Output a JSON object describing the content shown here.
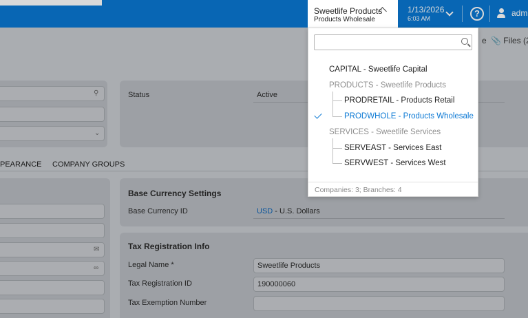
{
  "topbar": {
    "company_name": "Sweetlife Products",
    "branch_name": "Products Wholesale",
    "date": "1/13/2026",
    "time": "6:03 AM",
    "help_label": "?",
    "user_name": "adm"
  },
  "toolbar": {
    "partial_label": "e",
    "files_label": "Files (2"
  },
  "summary": {
    "status_label": "Status",
    "status_value": "Active"
  },
  "tabs": [
    "PEARANCE",
    "COMPANY GROUPS"
  ],
  "base_currency": {
    "heading": "Base Currency Settings",
    "label": "Base Currency ID",
    "code": "USD",
    "desc": " - U.S. Dollars"
  },
  "tax": {
    "heading": "Tax Registration Info",
    "legal_name_label": "Legal Name",
    "required_mark": "*",
    "legal_name_value": "Sweetlife Products",
    "tax_reg_label": "Tax Registration ID",
    "tax_reg_value": "190000060",
    "tax_exempt_label": "Tax Exemption Number",
    "tax_exempt_value": ""
  },
  "dropdown": {
    "search_placeholder": "",
    "items": [
      {
        "text": "CAPITAL - Sweetlife Capital",
        "kind": "company"
      },
      {
        "text": "PRODUCTS - Sweetlife Products",
        "kind": "group"
      },
      {
        "text": "PRODRETAIL - Products Retail",
        "kind": "branch"
      },
      {
        "text": "PRODWHOLE - Products Wholesale",
        "kind": "branch-selected"
      },
      {
        "text": "SERVICES - Sweetlife Services",
        "kind": "group"
      },
      {
        "text": "SERVEAST - Services East",
        "kind": "branch"
      },
      {
        "text": "SERVWEST - Services West",
        "kind": "branch"
      }
    ],
    "footer": "Companies: 3; Branches: 4"
  },
  "colors": {
    "accent": "#0a78d4",
    "selected": "#0a78d4"
  }
}
